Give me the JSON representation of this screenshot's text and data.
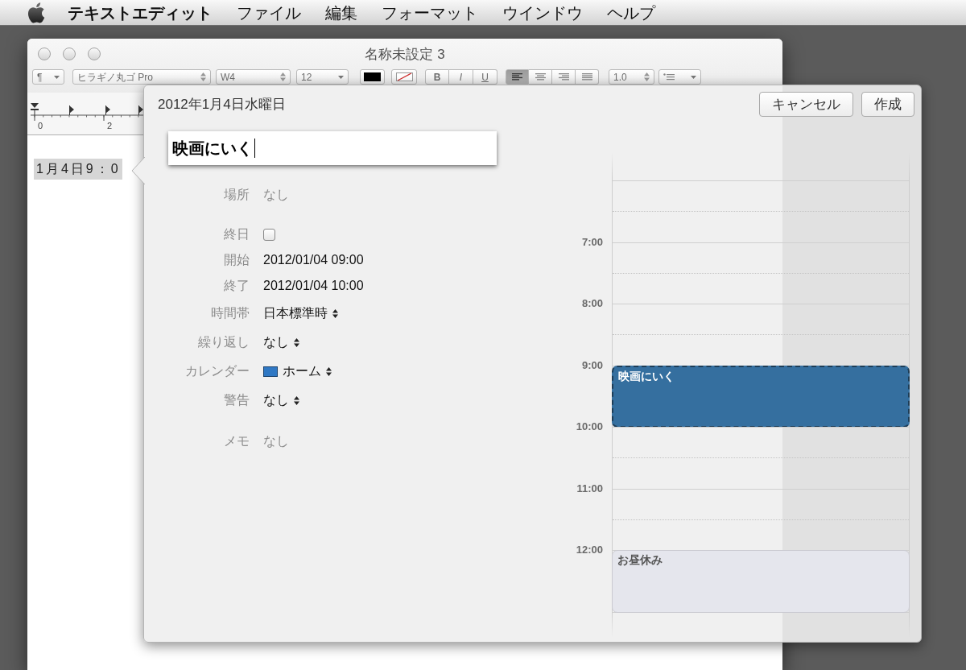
{
  "menu_bar": {
    "app_name": "テキストエディット",
    "menus": [
      "ファイル",
      "編集",
      "フォーマット",
      "ウインドウ",
      "ヘルプ"
    ]
  },
  "window": {
    "title": "名称未設定 3",
    "toolbar": {
      "paragraph": "¶",
      "font": "ヒラギノ丸ゴ Pro",
      "weight": "W4",
      "size": "12",
      "styles": [
        {
          "label": "B",
          "kind": "bold"
        },
        {
          "label": "I",
          "kind": "italic"
        },
        {
          "label": "U",
          "kind": "underline"
        }
      ],
      "alignments": [
        {
          "kind": "left",
          "selected": true
        },
        {
          "kind": "center",
          "selected": false
        },
        {
          "kind": "right",
          "selected": false
        },
        {
          "kind": "justify",
          "selected": false
        }
      ],
      "spacing": "1.0"
    },
    "ruler": {
      "labels": [
        "0",
        "2"
      ]
    },
    "document": {
      "selected_text": "1月4日9：0"
    }
  },
  "popover": {
    "date": "2012年1月4日水曜日",
    "buttons": [
      "キャンセル",
      "作成"
    ],
    "title_field": {
      "value": "映画にいく"
    },
    "form": [
      {
        "rows": [
          {
            "label": "場所",
            "kind": "field",
            "placeholder": "なし"
          }
        ]
      },
      {
        "rows": [
          {
            "label": "終日",
            "kind": "checkbox",
            "checked": false
          },
          {
            "label": "開始",
            "kind": "text",
            "value": "2012/01/04 09:00"
          },
          {
            "label": "終了",
            "kind": "text",
            "value": "2012/01/04 10:00"
          },
          {
            "label": "時間帯",
            "kind": "popup",
            "value": "日本標準時"
          },
          {
            "label": "繰り返し",
            "kind": "popup",
            "value": "なし"
          },
          {
            "label": "カレンダー",
            "kind": "popup",
            "value": "ホーム",
            "color": "#2f78c4"
          },
          {
            "label": "警告",
            "kind": "popup",
            "value": "なし"
          }
        ]
      },
      {
        "rows": [
          {
            "label": "メモ",
            "kind": "field",
            "placeholder": "なし"
          }
        ]
      }
    ],
    "day_view": {
      "hours": [
        {
          "label": "7:00"
        },
        {
          "label": "8:00"
        },
        {
          "label": "9:00",
          "events": [
            {
              "title": "映画にいく",
              "color": "#356f9f",
              "selected": true
            }
          ]
        },
        {
          "label": "10:00"
        },
        {
          "label": "11:00"
        },
        {
          "label": "12:00",
          "events": [
            {
              "title": "お昼休み",
              "color": "#e5e6ed",
              "selected": false
            }
          ]
        }
      ]
    }
  }
}
